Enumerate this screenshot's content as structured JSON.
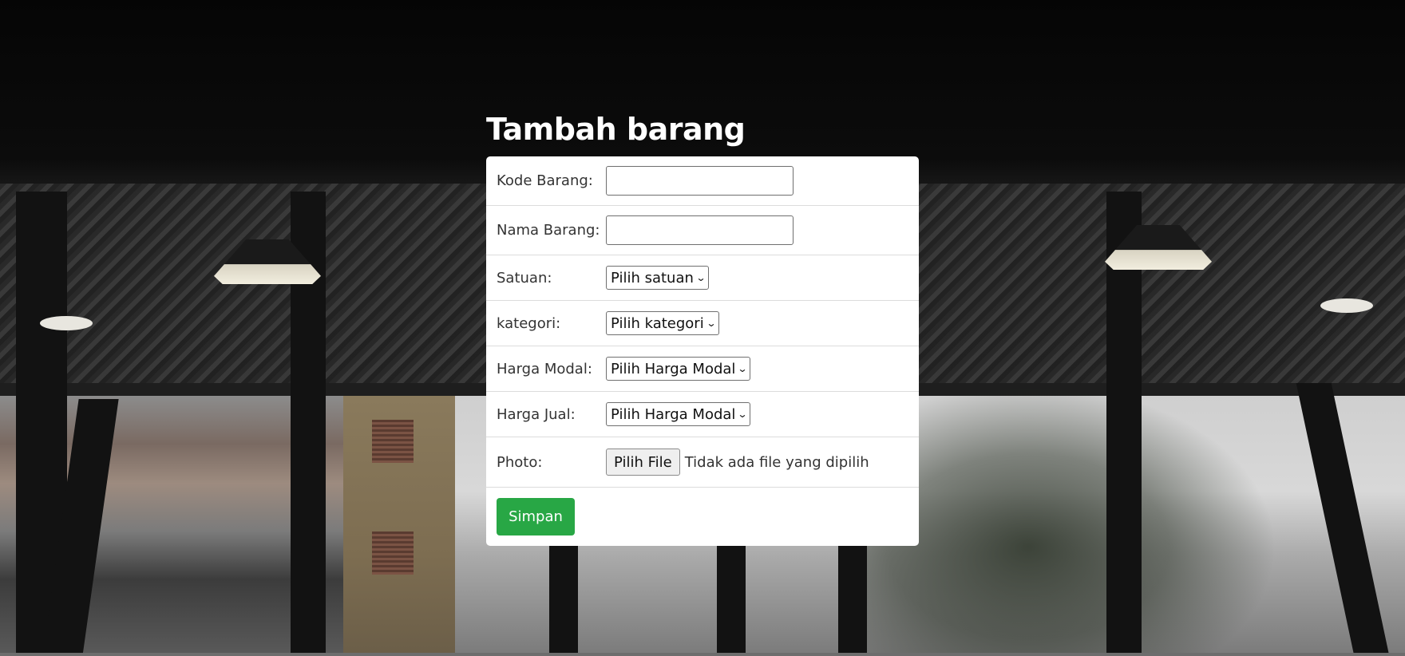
{
  "page": {
    "title": "Tambah barang"
  },
  "form": {
    "kode_barang": {
      "label": "Kode Barang:",
      "value": ""
    },
    "nama_barang": {
      "label": "Nama Barang:",
      "value": ""
    },
    "satuan": {
      "label": "Satuan:",
      "selected": "Pilih satuan"
    },
    "kategori": {
      "label": "kategori:",
      "selected": "Pilih kategori"
    },
    "harga_modal": {
      "label": "Harga Modal:",
      "selected": "Pilih Harga Modal"
    },
    "harga_jual": {
      "label": "Harga Jual:",
      "selected": "Pilih Harga Modal"
    },
    "photo": {
      "label": "Photo:",
      "button_label": "Pilih File",
      "status": "Tidak ada file yang dipilih"
    },
    "submit_label": "Simpan"
  },
  "colors": {
    "submit_button": "#28a745",
    "card_background": "#ffffff",
    "title_text": "#ffffff"
  },
  "icons": {
    "select_chevron": "chevron-down-icon"
  }
}
